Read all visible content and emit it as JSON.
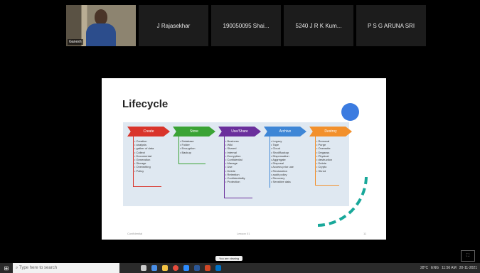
{
  "participants": [
    {
      "name": "Ganesh",
      "has_video": true
    },
    {
      "name": "J Rajasekhar"
    },
    {
      "name": "190050095 Shai..."
    },
    {
      "name": "5240 J R K Kum..."
    },
    {
      "name": "P S G ARUNA SRI"
    }
  ],
  "slide": {
    "title": "Lifecycle",
    "stages": [
      {
        "label": "Create",
        "color": "#d9342b",
        "items": [
          "Creation",
          "analysis",
          "gather of data",
          "Collect",
          "Documentat",
          "Generation",
          "Storage",
          "Overwriting",
          "Policy"
        ]
      },
      {
        "label": "Store",
        "color": "#3aa335",
        "items": [
          "Database",
          "Folder",
          "Encryption",
          "Backup"
        ]
      },
      {
        "label": "Use/Share",
        "color": "#6a2f9c",
        "items": [
          "Business",
          "Wiki",
          "Shared",
          "Internal",
          "Encryption",
          "Confidential",
          "Manage",
          "Use",
          "Delete",
          "Retention",
          "Confidentiality",
          "Protection"
        ]
      },
      {
        "label": "Archive",
        "color": "#3e86d6",
        "items": [
          "Legacy",
          "Tape",
          "Cloud",
          "Shut/Backup",
          "Dispensation",
          "Aggregate",
          "Disposal",
          "Access prior use",
          "Restoration",
          "audit policy",
          "Recovery",
          "Sensitive data"
        ]
      },
      {
        "label": "Destroy",
        "color": "#f2902c",
        "items": [
          "Removal",
          "Purge",
          "Overwrite",
          "Degauss",
          "Physical",
          "destruction",
          "Delete",
          "Crypto",
          "Shred"
        ]
      }
    ],
    "footer_left": "Confidential",
    "footer_center": "Lesson 01",
    "footer_right": "11"
  },
  "share_label": "You are viewing",
  "taskbar": {
    "search_placeholder": "Type here to search",
    "time": "11:56 AM",
    "date": "20-11-2021",
    "language": "ENG",
    "temperature": "28°C"
  },
  "icons": [
    "windows-start-icon",
    "search-icon",
    "task-view-icon",
    "chrome-icon",
    "edge-icon",
    "file-explorer-icon",
    "zoom-icon",
    "word-icon",
    "powerpoint-icon",
    "outlook-icon"
  ]
}
